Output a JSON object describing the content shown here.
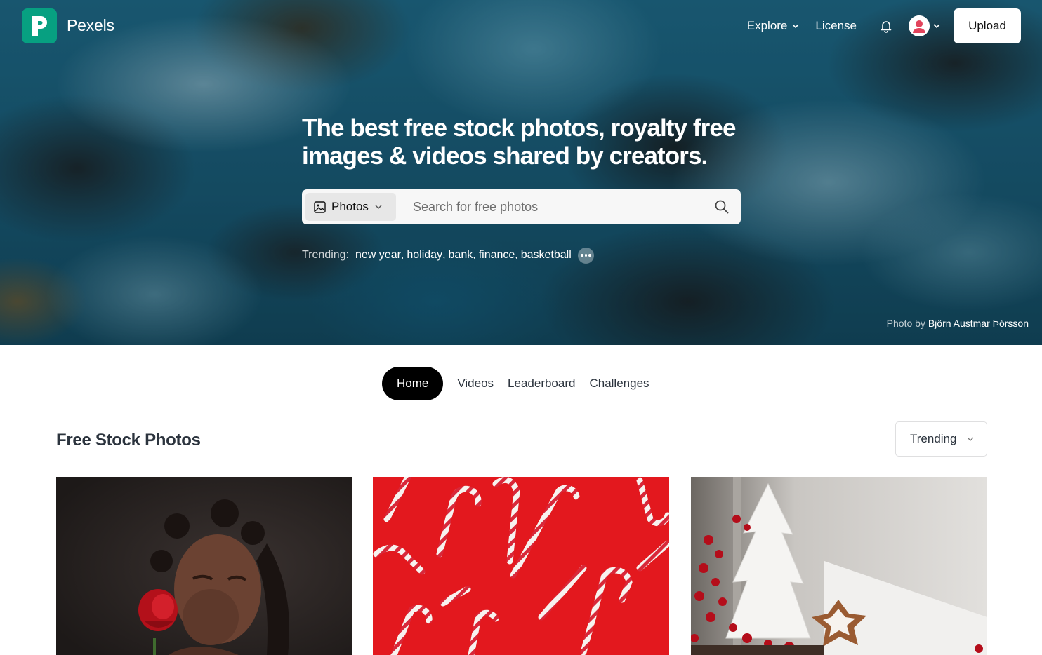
{
  "header": {
    "brand": "Pexels",
    "nav": {
      "explore": "Explore",
      "license": "License",
      "upload": "Upload"
    }
  },
  "hero": {
    "headline": "The best free stock photos, royalty free images & videos shared by creators.",
    "search": {
      "type_label": "Photos",
      "placeholder": "Search for free photos"
    },
    "trending": {
      "label": "Trending:",
      "items": [
        "new year",
        "holiday",
        "bank",
        "finance",
        "basketball"
      ]
    },
    "credit": {
      "prefix": "Photo by",
      "photographer": "Björn Austmar Þórsson"
    }
  },
  "tabs": [
    "Home",
    "Videos",
    "Leaderboard",
    "Challenges"
  ],
  "section": {
    "title": "Free Stock Photos",
    "sort_value": "Trending"
  },
  "photos": [
    {
      "subject": "woman-with-rose"
    },
    {
      "subject": "candy-canes-on-red"
    },
    {
      "subject": "christmas-tree-decor-window"
    }
  ],
  "colors": {
    "brand": "#07a081",
    "active_tab": "#000000",
    "text": "#2c343e"
  }
}
